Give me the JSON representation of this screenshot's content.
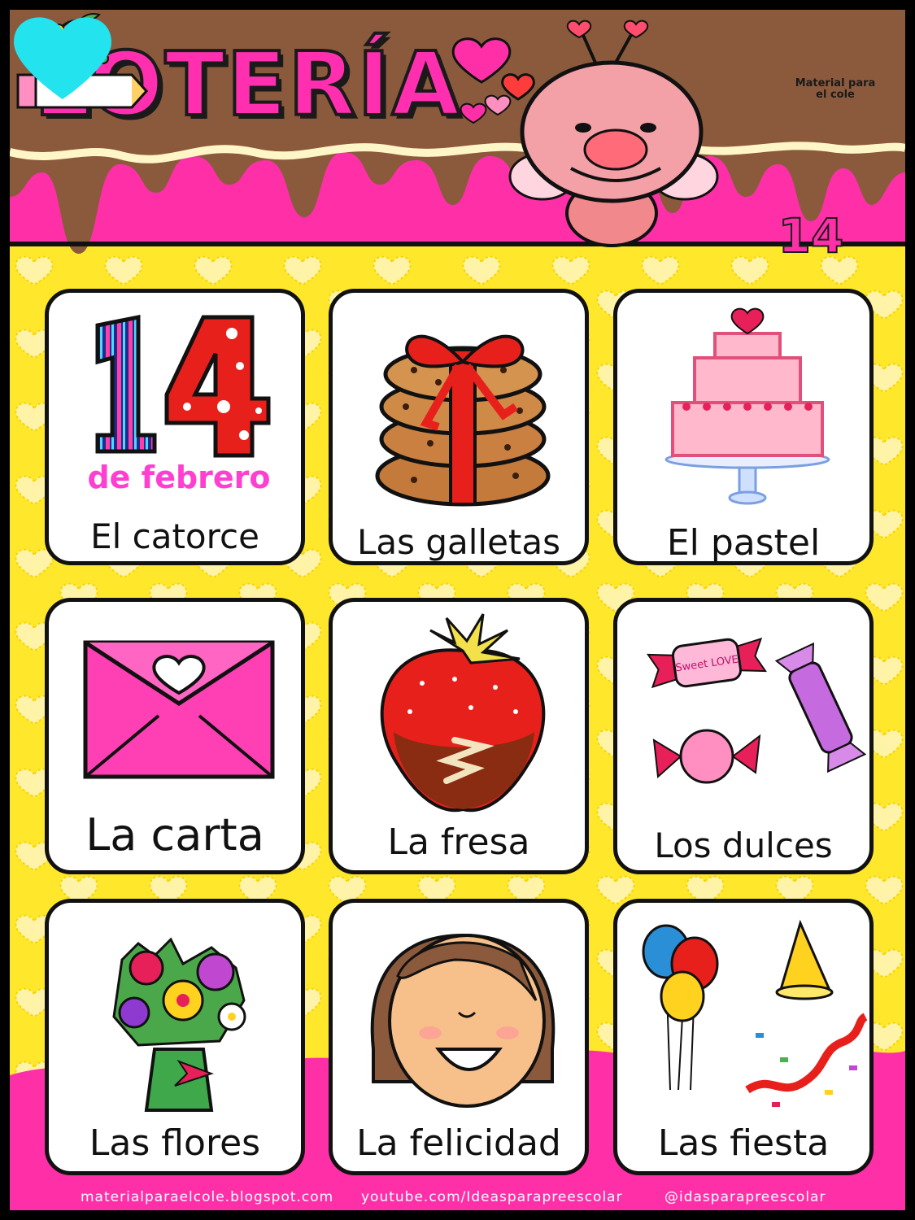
{
  "title": "LOTERÍA",
  "board_number": "14",
  "logo": {
    "line1": "Material para",
    "line2": "el cole"
  },
  "colors": {
    "pink": "#ff2fa8",
    "yellow": "#ffe82b",
    "chocolate": "#8b5a3c",
    "cyan": "#22e3ee"
  },
  "cards": [
    {
      "label": "El catorce",
      "icon": "fourteen-february-icon",
      "art_text": {
        "number": "14",
        "caption": "de febrero"
      }
    },
    {
      "label": "Las galletas",
      "icon": "cookies-with-ribbon-icon"
    },
    {
      "label": "El pastel",
      "icon": "cake-icon"
    },
    {
      "label": "La carta",
      "icon": "envelope-heart-icon"
    },
    {
      "label": "La fresa",
      "icon": "chocolate-strawberry-icon"
    },
    {
      "label": "Los dulces",
      "icon": "candies-icon",
      "art_text": {
        "wrapper": "Sweet LOVE"
      }
    },
    {
      "label": "Las flores",
      "icon": "flower-bouquet-icon"
    },
    {
      "label": "La felicidad",
      "icon": "happy-face-icon"
    },
    {
      "label": "Las fiesta",
      "icon": "party-balloons-hat-icon"
    }
  ],
  "footer": {
    "blog": "materialparaelcole.blogspot.com",
    "youtube": "youtube.com/Ideasparapreescolar",
    "instagram": "@idasparapreescolar"
  }
}
